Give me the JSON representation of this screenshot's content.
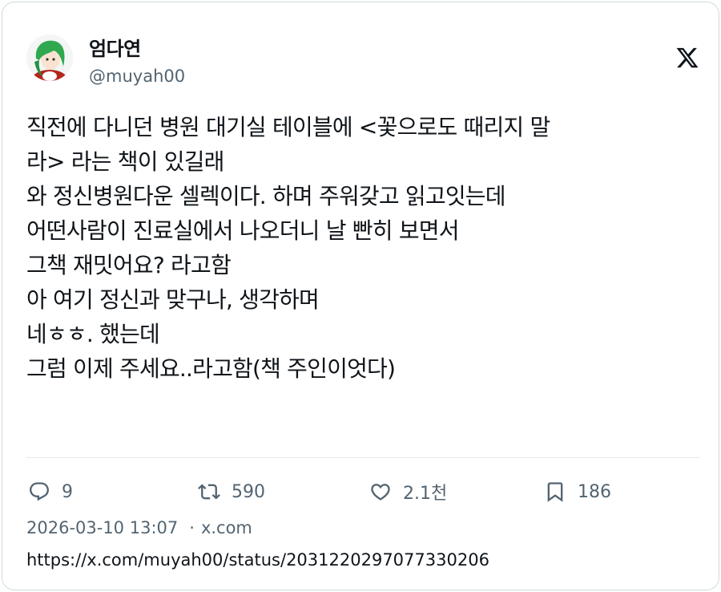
{
  "author": {
    "display_name": "엄다연",
    "handle": "@muyah00"
  },
  "brand": {
    "logo_icon": "x-logo-icon"
  },
  "tweet": {
    "lines": [
      "직전에 다니던 병원 대기실 테이블에 <꽃으로도 때리지 말",
      "라> 라는 책이 있길래",
      "와 정신병원다운 셀렉이다. 하며 주워갖고 읽고잇는데",
      "어떤사람이 진료실에서 나오더니 날 빤히 보면서",
      "그책 재밋어요? 라고함",
      "아 여기 정신과 맞구나, 생각하며",
      "네ㅎㅎ. 했는데",
      "그럼 이제 주세요..라고함(책 주인이엇다)"
    ]
  },
  "actions": {
    "reply": {
      "icon": "reply-icon",
      "count": "9"
    },
    "retweet": {
      "icon": "retweet-icon",
      "count": "590"
    },
    "like": {
      "icon": "heart-icon",
      "count": "2.1천"
    },
    "bookmark": {
      "icon": "bookmark-icon",
      "count": "186"
    }
  },
  "meta": {
    "timestamp": "2026-03-10 13:07",
    "separator": "·",
    "source": "x.com"
  },
  "url": "https://x.com/muyah00/status/2031220297077330206",
  "colors": {
    "text_primary": "#0f1419",
    "text_secondary": "#536471",
    "border": "#cfd9de"
  }
}
